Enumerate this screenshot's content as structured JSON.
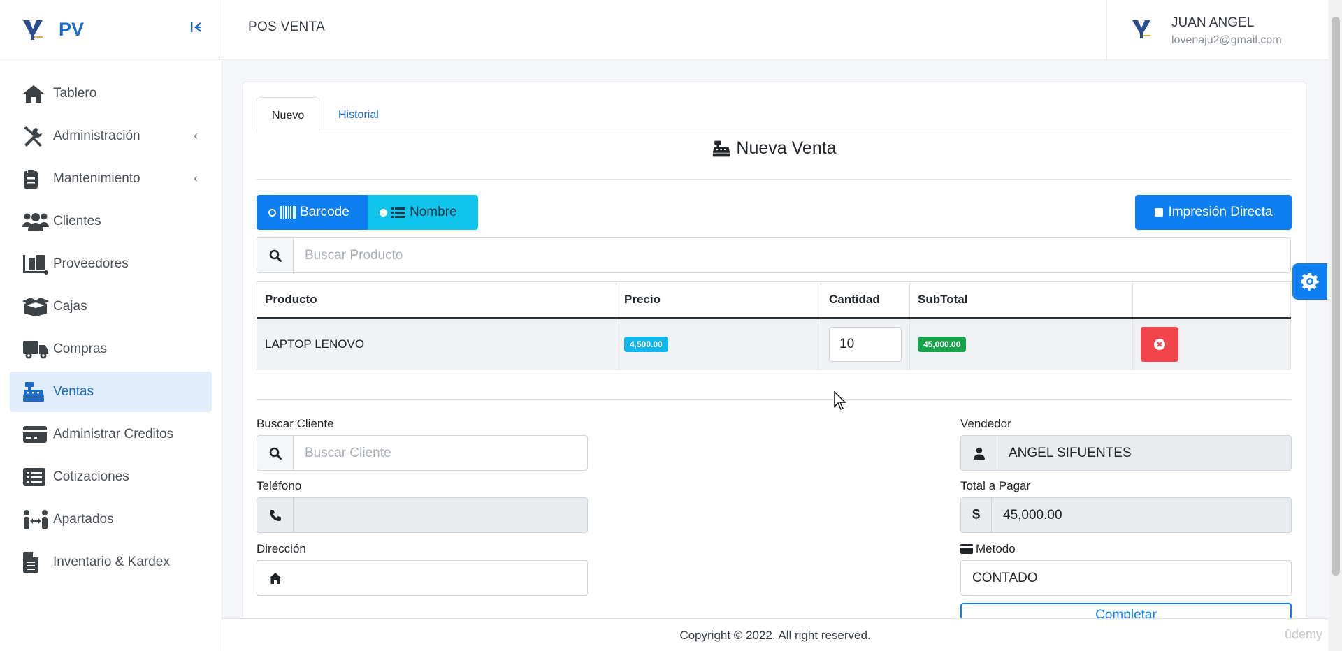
{
  "sidebar": {
    "brand": "PV",
    "items": [
      {
        "label": "Tablero",
        "icon": "home-icon"
      },
      {
        "label": "Administración",
        "icon": "tools-icon"
      },
      {
        "label": "Mantenimiento",
        "icon": "clipboard-icon"
      },
      {
        "label": "Clientes",
        "icon": "users-icon"
      },
      {
        "label": "Proveedores",
        "icon": "dolly-icon"
      },
      {
        "label": "Cajas",
        "icon": "box-open-icon"
      },
      {
        "label": "Compras",
        "icon": "truck-icon"
      },
      {
        "label": "Ventas",
        "icon": "cash-register-icon"
      },
      {
        "label": "Administrar Creditos",
        "icon": "credit-card-icon"
      },
      {
        "label": "Cotizaciones",
        "icon": "list-icon"
      },
      {
        "label": "Apartados",
        "icon": "people-arrows-icon"
      },
      {
        "label": "Inventario & Kardex",
        "icon": "file-icon"
      }
    ]
  },
  "header": {
    "title": "POS VENTA",
    "user_name": "JUAN ANGEL",
    "user_email": "lovenaju2@gmail.com"
  },
  "tabs": {
    "nuevo": "Nuevo",
    "historial": "Historial"
  },
  "section_title": "Nueva Venta",
  "search_mode": {
    "barcode": "Barcode",
    "nombre": "Nombre",
    "selected": "Nombre"
  },
  "print_button": "Impresión Directa",
  "product_search": {
    "placeholder": "Buscar Producto"
  },
  "table": {
    "headers": [
      "Producto",
      "Precio",
      "Cantidad",
      "SubTotal"
    ],
    "rows": [
      {
        "producto": "LAPTOP LENOVO",
        "precio": "4,500.00",
        "cantidad": "10",
        "subtotal": "45,000.00"
      }
    ]
  },
  "customer": {
    "search_label": "Buscar Cliente",
    "search_placeholder": "Buscar Cliente",
    "phone_label": "Teléfono",
    "address_label": "Dirección"
  },
  "sale": {
    "seller_label": "Vendedor",
    "seller": "ANGEL SIFUENTES",
    "total_label": "Total a Pagar",
    "currency": "$",
    "total": "45,000.00",
    "method_label": "Metodo",
    "method": "CONTADO",
    "complete_button": "Completar"
  },
  "footer": {
    "copyright": "Copyright © 2022. All right reserved."
  },
  "watermark": "ûdemy",
  "colors": {
    "primary": "#0d7ff0",
    "info": "#11c4ec",
    "danger": "#f2454b",
    "success": "#17a34a",
    "active_bg": "#e0edfb"
  }
}
